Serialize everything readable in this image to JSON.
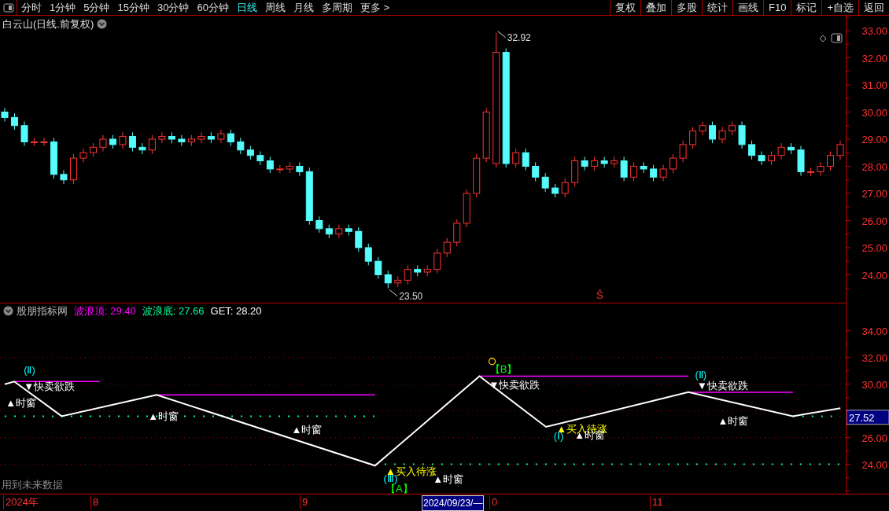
{
  "toolbar": {
    "periods": [
      {
        "label": "分时",
        "selected": false
      },
      {
        "label": "1分钟",
        "selected": false
      },
      {
        "label": "5分钟",
        "selected": false
      },
      {
        "label": "15分钟",
        "selected": false
      },
      {
        "label": "30分钟",
        "selected": false
      },
      {
        "label": "60分钟",
        "selected": false
      },
      {
        "label": "日线",
        "selected": true
      },
      {
        "label": "周线",
        "selected": false
      },
      {
        "label": "月线",
        "selected": false
      },
      {
        "label": "多周期",
        "selected": false
      },
      {
        "label": "更多 >",
        "selected": false
      }
    ],
    "buttons": [
      "复权",
      "叠加",
      "多股",
      "统计",
      "画线",
      "F10",
      "标记",
      "+自选",
      "返回"
    ]
  },
  "price_panel": {
    "title": "白云山(日线.前复权)",
    "yticks": [
      "33.00",
      "32.00",
      "31.00",
      "30.00",
      "29.00",
      "28.00",
      "27.00",
      "26.00",
      "25.00",
      "24.00"
    ],
    "high_label": "32.92",
    "low_label": "23.50",
    "signal": "Ŝ"
  },
  "indicator_panel": {
    "name": "股朋指标网",
    "legend": [
      {
        "label": "波浪顶: 29.40",
        "color": "#ff00ff"
      },
      {
        "label": "波浪底: 27.66",
        "color": "#00ff99"
      },
      {
        "label": "GET: 28.20",
        "color": "#ffffff"
      }
    ],
    "wave_levels": [
      {
        "kind": "top",
        "color": "#ff00ff"
      },
      {
        "kind": "bottom",
        "color": "#00ff99"
      },
      {
        "kind": "wave",
        "color": "#ffffff"
      }
    ],
    "yticks": [
      "34.00",
      "32.00",
      "30.00",
      "26.00",
      "24.00"
    ],
    "signals": [
      {
        "kind": "text",
        "text": "(Ⅱ)",
        "color": "#00ffff"
      },
      {
        "kind": "text",
        "text": "▼快卖欲跌",
        "color": "#ffffff"
      },
      {
        "kind": "text",
        "text": "▲时窗",
        "color": "#ffffff"
      },
      {
        "kind": "text",
        "text": "▲时窗",
        "color": "#ffffff"
      },
      {
        "kind": "text",
        "text": "▲时窗",
        "color": "#ffffff"
      },
      {
        "kind": "text",
        "text": "▲买入待涨",
        "color": "#ffff00"
      },
      {
        "kind": "text",
        "text": "(Ⅲ)",
        "color": "#00ffff"
      },
      {
        "kind": "text",
        "text": "【A】",
        "color": "#00ff00"
      },
      {
        "kind": "text",
        "text": "▲时窗",
        "color": "#ffffff"
      },
      {
        "kind": "marker",
        "color": "#ffcc00"
      },
      {
        "kind": "text",
        "text": "【B】",
        "color": "#00ff00"
      },
      {
        "kind": "text",
        "text": "▼快卖欲跌",
        "color": "#ffffff"
      },
      {
        "kind": "text",
        "text": "▲买入待涨",
        "color": "#ffff00"
      },
      {
        "kind": "text",
        "text": "(Ⅰ)",
        "color": "#00ffff"
      },
      {
        "kind": "text",
        "text": "▲时窗",
        "color": "#ffffff"
      },
      {
        "kind": "text",
        "text": "(Ⅱ)",
        "color": "#00ffff"
      },
      {
        "kind": "text",
        "text": "▼快卖欲跌",
        "color": "#ffffff"
      },
      {
        "kind": "text",
        "text": "▲时窗",
        "color": "#ffffff"
      }
    ],
    "last_value": "27.52",
    "note": "用到未来数据"
  },
  "date_axis": [
    {
      "kind": "year",
      "text": "2024年"
    },
    {
      "kind": "month",
      "text": "8"
    },
    {
      "kind": "month",
      "text": "9"
    },
    {
      "kind": "cursor",
      "text": "2024/09/23/—"
    },
    {
      "kind": "month",
      "text": "0"
    },
    {
      "kind": "month",
      "text": "11"
    }
  ]
}
